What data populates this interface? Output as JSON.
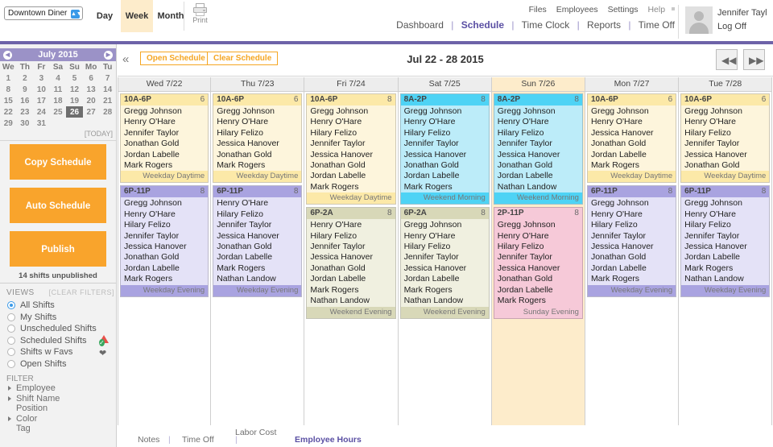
{
  "topbar": {
    "company": "Downtown Diner",
    "view_tabs": [
      {
        "label": "Day",
        "active": false
      },
      {
        "label": "Week",
        "active": true
      },
      {
        "label": "Month",
        "active": false
      }
    ],
    "print_label": "Print",
    "secondary_nav": [
      "Files",
      "Employees",
      "Settings"
    ],
    "help_label": "Help",
    "primary_nav": [
      {
        "label": "Dashboard",
        "current": false
      },
      {
        "label": "Schedule",
        "current": true
      },
      {
        "label": "Time Clock",
        "current": false
      },
      {
        "label": "Reports",
        "current": false
      },
      {
        "label": "Time Off",
        "current": false
      }
    ],
    "user_name": "Jennifer Tayl",
    "log_off": "Log Off",
    "accent_purple": "#6d63a8"
  },
  "sidebar": {
    "calendar": {
      "title": "July 2015",
      "prev_icon": "chevron-left-icon",
      "next_icon": "chevron-right-icon",
      "weekdays": [
        "We",
        "Th",
        "Fr",
        "Sa",
        "Su",
        "Mo",
        "Tu"
      ],
      "weeks": [
        [
          "1",
          "2",
          "3",
          "4",
          "5",
          "6",
          "7"
        ],
        [
          "8",
          "9",
          "10",
          "11",
          "12",
          "13",
          "14"
        ],
        [
          "15",
          "16",
          "17",
          "18",
          "19",
          "20",
          "21"
        ],
        [
          "22",
          "23",
          "24",
          "25",
          "26",
          "27",
          "28"
        ],
        [
          "29",
          "30",
          "31",
          "",
          "",
          "",
          ""
        ]
      ],
      "today": "26",
      "today_label": "[TODAY]"
    },
    "buttons": [
      {
        "label": "Copy Schedule"
      },
      {
        "label": "Auto Schedule"
      },
      {
        "label": "Publish"
      }
    ],
    "unpublished": "14 shifts unpublished",
    "views_header": "VIEWS",
    "clear_filters": "[CLEAR FILTERS]",
    "views": [
      {
        "label": "All Shifts",
        "selected": true,
        "icon": ""
      },
      {
        "label": "My Shifts",
        "selected": false,
        "icon": ""
      },
      {
        "label": "Unscheduled Shifts",
        "selected": false,
        "icon": "warning-triangle-icon"
      },
      {
        "label": "Scheduled Shifts",
        "selected": false,
        "icon": "check-circle-icon"
      },
      {
        "label": "Shifts w Favs",
        "selected": false,
        "icon": "heart-icon"
      },
      {
        "label": "Open Shifts",
        "selected": false,
        "icon": "blue-square-icon"
      }
    ],
    "filter_header": "FILTER",
    "filters": [
      {
        "label": "Employee",
        "expandable": true
      },
      {
        "label": "Shift Name",
        "expandable": true
      },
      {
        "label": "Position",
        "expandable": false
      },
      {
        "label": "Color",
        "expandable": true
      },
      {
        "label": "Tag",
        "expandable": false
      }
    ]
  },
  "schedule": {
    "collapse_icon": "double-chevron-left-icon",
    "open_schedule": "Open Schedule",
    "clear_schedule": "Clear Schedule",
    "date_range": "Jul 22 - 28 2015",
    "prev_week_icon": "double-arrow-left-icon",
    "next_week_icon": "double-arrow-right-icon",
    "days": [
      {
        "header": "Wed 7/22",
        "highlight": false,
        "shifts": [
          {
            "time": "10A-6P",
            "count": "6",
            "tag": "Weekday Daytime",
            "color": "#fce9a8",
            "body": "#fdf5dc",
            "names": [
              "Gregg Johnson",
              "Henry O'Hare",
              "Jennifer Taylor",
              "Jonathan Gold",
              "Jordan Labelle",
              "Mark Rogers"
            ]
          },
          {
            "time": "6P-11P",
            "count": "8",
            "tag": "Weekday Evening",
            "color": "#a9a3e0",
            "body": "#e4e2f7",
            "names": [
              "Gregg Johnson",
              "Henry O'Hare",
              "Hilary Felizo",
              "Jennifer Taylor",
              "Jessica Hanover",
              "Jonathan Gold",
              "Jordan Labelle",
              "Mark Rogers"
            ]
          }
        ]
      },
      {
        "header": "Thu 7/23",
        "highlight": false,
        "shifts": [
          {
            "time": "10A-6P",
            "count": "6",
            "tag": "Weekday Daytime",
            "color": "#fce9a8",
            "body": "#fdf5dc",
            "names": [
              "Gregg Johnson",
              "Henry O'Hare",
              "Hilary Felizo",
              "Jessica Hanover",
              "Jonathan Gold",
              "Mark Rogers"
            ]
          },
          {
            "time": "6P-11P",
            "count": "8",
            "tag": "Weekday Evening",
            "color": "#a9a3e0",
            "body": "#e4e2f7",
            "names": [
              "Henry O'Hare",
              "Hilary Felizo",
              "Jennifer Taylor",
              "Jessica Hanover",
              "Jonathan Gold",
              "Jordan Labelle",
              "Mark Rogers",
              "Nathan Landow"
            ]
          }
        ]
      },
      {
        "header": "Fri 7/24",
        "highlight": false,
        "shifts": [
          {
            "time": "10A-6P",
            "count": "8",
            "tag": "Weekday Daytime",
            "color": "#fce9a8",
            "body": "#fdf5dc",
            "names": [
              "Gregg Johnson",
              "Henry O'Hare",
              "Hilary Felizo",
              "Jennifer Taylor",
              "Jessica Hanover",
              "Jonathan Gold",
              "Jordan Labelle",
              "Mark Rogers"
            ]
          },
          {
            "time": "6P-2A",
            "count": "8",
            "tag": "Weekend Evening",
            "color": "#d8d8b8",
            "body": "#f0f0e0",
            "names": [
              "Henry O'Hare",
              "Hilary Felizo",
              "Jennifer Taylor",
              "Jessica Hanover",
              "Jonathan Gold",
              "Jordan Labelle",
              "Mark Rogers",
              "Nathan Landow"
            ]
          }
        ]
      },
      {
        "header": "Sat 7/25",
        "highlight": false,
        "shifts": [
          {
            "time": "8A-2P",
            "count": "8",
            "tag": "Weekend Morning",
            "color": "#4ed3f5",
            "body": "#bcecf9",
            "names": [
              "Gregg Johnson",
              "Henry O'Hare",
              "Hilary Felizo",
              "Jennifer Taylor",
              "Jessica Hanover",
              "Jonathan Gold",
              "Jordan Labelle",
              "Mark Rogers"
            ]
          },
          {
            "time": "6P-2A",
            "count": "8",
            "tag": "Weekend Evening",
            "color": "#d8d8b8",
            "body": "#f0f0e0",
            "names": [
              "Gregg Johnson",
              "Henry O'Hare",
              "Hilary Felizo",
              "Jennifer Taylor",
              "Jessica Hanover",
              "Jordan Labelle",
              "Mark Rogers",
              "Nathan Landow"
            ]
          }
        ]
      },
      {
        "header": "Sun 7/26",
        "highlight": true,
        "shifts": [
          {
            "time": "8A-2P",
            "count": "8",
            "tag": "Weekend Morning",
            "color": "#4ed3f5",
            "body": "#bcecf9",
            "names": [
              "Gregg Johnson",
              "Henry O'Hare",
              "Hilary Felizo",
              "Jennifer Taylor",
              "Jessica Hanover",
              "Jonathan Gold",
              "Jordan Labelle",
              "Nathan Landow"
            ]
          },
          {
            "time": "2P-11P",
            "count": "8",
            "tag": "Sunday Evening",
            "color": "#e username",
            "body": "#f6c9d8",
            "names": [
              "Gregg Johnson",
              "Henry O'Hare",
              "Hilary Felizo",
              "Jennifer Taylor",
              "Jessica Hanover",
              "Jonathan Gold",
              "Jordan Labelle",
              "Mark Rogers"
            ]
          }
        ]
      },
      {
        "header": "Mon 7/27",
        "highlight": false,
        "shifts": [
          {
            "time": "10A-6P",
            "count": "6",
            "tag": "Weekday Daytime",
            "color": "#fce9a8",
            "body": "#fdf5dc",
            "names": [
              "Gregg Johnson",
              "Henry O'Hare",
              "Jessica Hanover",
              "Jonathan Gold",
              "Jordan Labelle",
              "Mark Rogers"
            ]
          },
          {
            "time": "6P-11P",
            "count": "8",
            "tag": "Weekday Evening",
            "color": "#a9a3e0",
            "body": "#e4e2f7",
            "names": [
              "Gregg Johnson",
              "Henry O'Hare",
              "Hilary Felizo",
              "Jennifer Taylor",
              "Jessica Hanover",
              "Jonathan Gold",
              "Jordan Labelle",
              "Mark Rogers"
            ]
          }
        ]
      },
      {
        "header": "Tue 7/28",
        "highlight": false,
        "shifts": [
          {
            "time": "10A-6P",
            "count": "6",
            "tag": "Weekday Daytime",
            "color": "#fce9a8",
            "body": "#fdf5dc",
            "names": [
              "Gregg Johnson",
              "Henry O'Hare",
              "Hilary Felizo",
              "Jennifer Taylor",
              "Jessica Hanover",
              "Jonathan Gold"
            ]
          },
          {
            "time": "6P-11P",
            "count": "8",
            "tag": "Weekday Evening",
            "color": "#a9a3e0",
            "body": "#e4e2f7",
            "names": [
              "Gregg Johnson",
              "Henry O'Hare",
              "Hilary Felizo",
              "Jennifer Taylor",
              "Jessica Hanover",
              "Jordan Labelle",
              "Mark Rogers",
              "Nathan Landow"
            ]
          }
        ]
      }
    ]
  },
  "bottom_tabs": [
    {
      "label": "Notes",
      "current": false
    },
    {
      "label": "Time Off",
      "current": false
    },
    {
      "label": "Labor Cost",
      "current": false
    },
    {
      "label": "Employee Hours",
      "current": true
    }
  ]
}
